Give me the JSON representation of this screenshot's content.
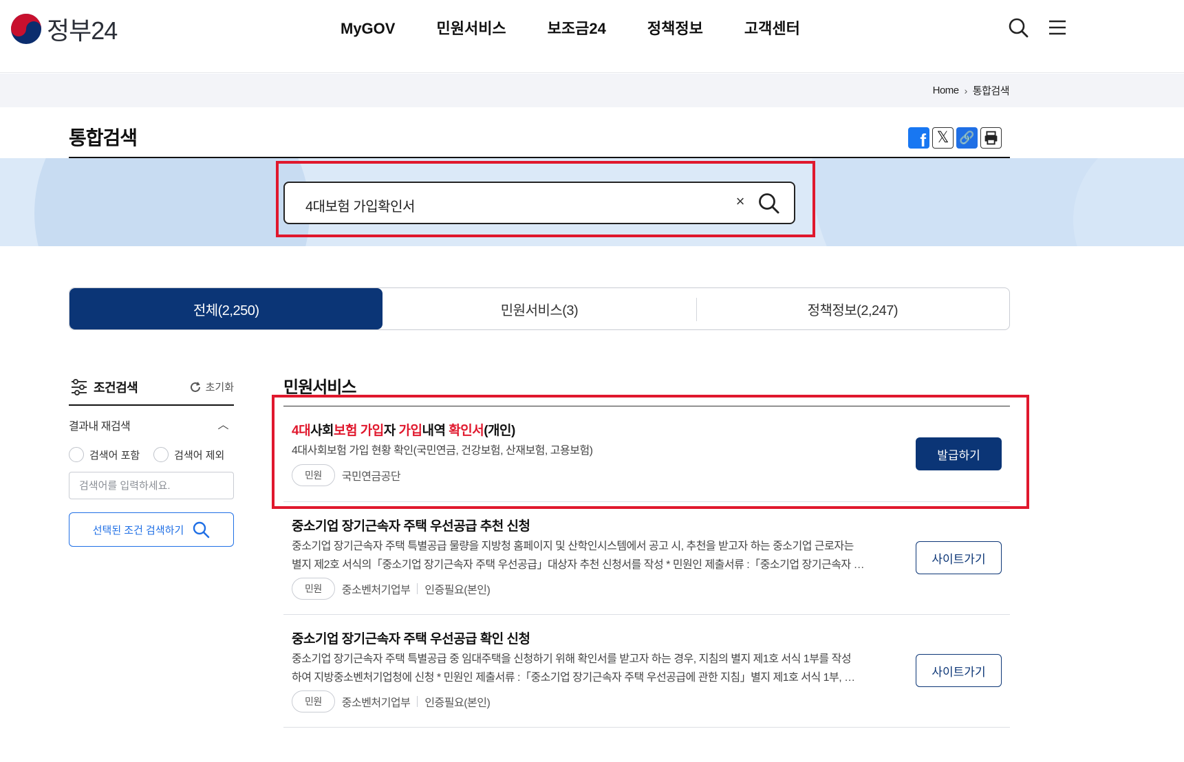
{
  "header": {
    "logo_text": "정부24",
    "nav": [
      "MyGOV",
      "민원서비스",
      "보조금24",
      "정책정보",
      "고객센터"
    ],
    "icons": [
      "search-icon",
      "menu-icon"
    ]
  },
  "breadcrumb": {
    "home": "Home",
    "current": "통합검색"
  },
  "page": {
    "title": "통합검색"
  },
  "share": [
    "facebook-icon",
    "x-icon",
    "link-icon",
    "print-icon"
  ],
  "search": {
    "value": "4대보험 가입확인서",
    "clear_label": "×"
  },
  "tabs": [
    {
      "label": "전체(2,250)",
      "active": true
    },
    {
      "label": "민원서비스(3)",
      "active": false
    },
    {
      "label": "정책정보(2,247)",
      "active": false
    }
  ],
  "filter": {
    "title": "조건검색",
    "reset": "초기화",
    "refine_title": "결과내 재검색",
    "include_label": "검색어 포함",
    "exclude_label": "검색어 제외",
    "input_placeholder": "검색어를 입력하세요.",
    "apply_label": "선택된 조건 검색하기"
  },
  "results": {
    "section_title": "민원서비스",
    "items": [
      {
        "title_parts": [
          {
            "t": "4대",
            "hl": true
          },
          {
            "t": "사회",
            "hl": false
          },
          {
            "t": "보험",
            "hl": true
          },
          {
            "t": " ",
            "hl": false
          },
          {
            "t": "가입",
            "hl": true
          },
          {
            "t": "자 ",
            "hl": false
          },
          {
            "t": "가입",
            "hl": true
          },
          {
            "t": "내역 ",
            "hl": false
          },
          {
            "t": "확인서",
            "hl": true
          },
          {
            "t": "(개인)",
            "hl": false
          }
        ],
        "desc1": "4대사회보험 가입 현황 확인(국민연금, 건강보험, 산재보험, 고용보험)",
        "desc2": "",
        "badge": "민원",
        "org": "국민연금공단",
        "auth": "",
        "button": "발급하기"
      },
      {
        "title": "중소기업 장기근속자 주택 우선공급 추천 신청",
        "desc1": "중소기업 장기근속자 주택 특별공급 물량을 지방청 홈페이지 및 산학인시스템에서 공고 시, 추천을 받고자 하는 중소기업 근로자는",
        "desc2": "별지 제2호 서식의「중소기업 장기근속자 주택 우선공급」대상자 추천 신청서를 작성 * 민원인 제출서류 :「중소기업 장기근속자 …",
        "badge": "민원",
        "org": "중소벤처기업부",
        "auth": "인증필요(본인)",
        "button": "사이트가기"
      },
      {
        "title": "중소기업 장기근속자 주택 우선공급 확인 신청",
        "desc1": "중소기업 장기근속자 주택 특별공급 중 임대주택을 신청하기 위해 확인서를 받고자 하는 경우, 지침의 별지 제1호 서식 1부를 작성",
        "desc2": "하여 지방중소벤처기업청에 신청 * 민원인 제출서류 :「중소기업 장기근속자 주택 우선공급에 관한 지침」별지 제1호 서식 1부, …",
        "badge": "민원",
        "org": "중소벤처기업부",
        "auth": "인증필요(본인)",
        "button": "사이트가기"
      }
    ]
  },
  "colors": {
    "primary": "#0b3576",
    "highlight": "#e0182d",
    "accent_blue": "#1f6fe5",
    "band": "#dbe9f8"
  }
}
